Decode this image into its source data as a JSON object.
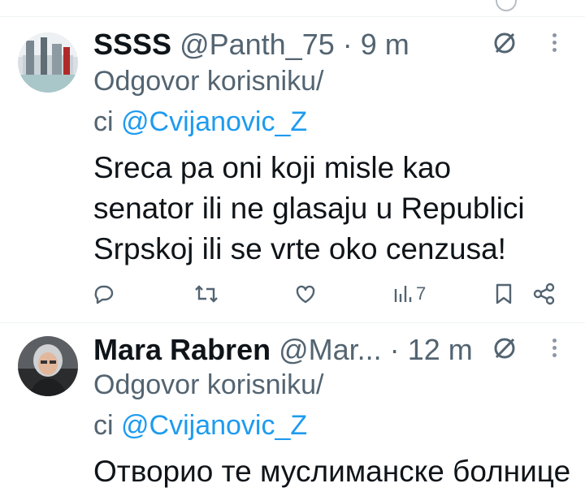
{
  "tweets": [
    {
      "name": "SSSS",
      "handle": "@Panth_75",
      "separator": "·",
      "time": "9 m",
      "reply_prefix": "Odgovor korisniku/",
      "reply_prefix2": "ci",
      "reply_mention": "@Cvijanovic_Z",
      "text_lines": [
        "Sreca pa oni koji misle kao",
        "senator ili ne glasaju u Republici",
        "Srpskoj ili se vrte oko cenzusa!"
      ],
      "views": "7"
    },
    {
      "name": "Mara Rabren",
      "handle": "@Mar...",
      "separator": "·",
      "time": "12 m",
      "reply_prefix": "Odgovor korisniku/",
      "reply_prefix2": "ci",
      "reply_mention": "@Cvijanovic_Z",
      "partial_text": "Отворио те муслиманске болнице"
    }
  ],
  "colors": {
    "text": "#0f1419",
    "secondary": "#536471",
    "mention": "#1d9bf0",
    "icon": "#536471"
  }
}
